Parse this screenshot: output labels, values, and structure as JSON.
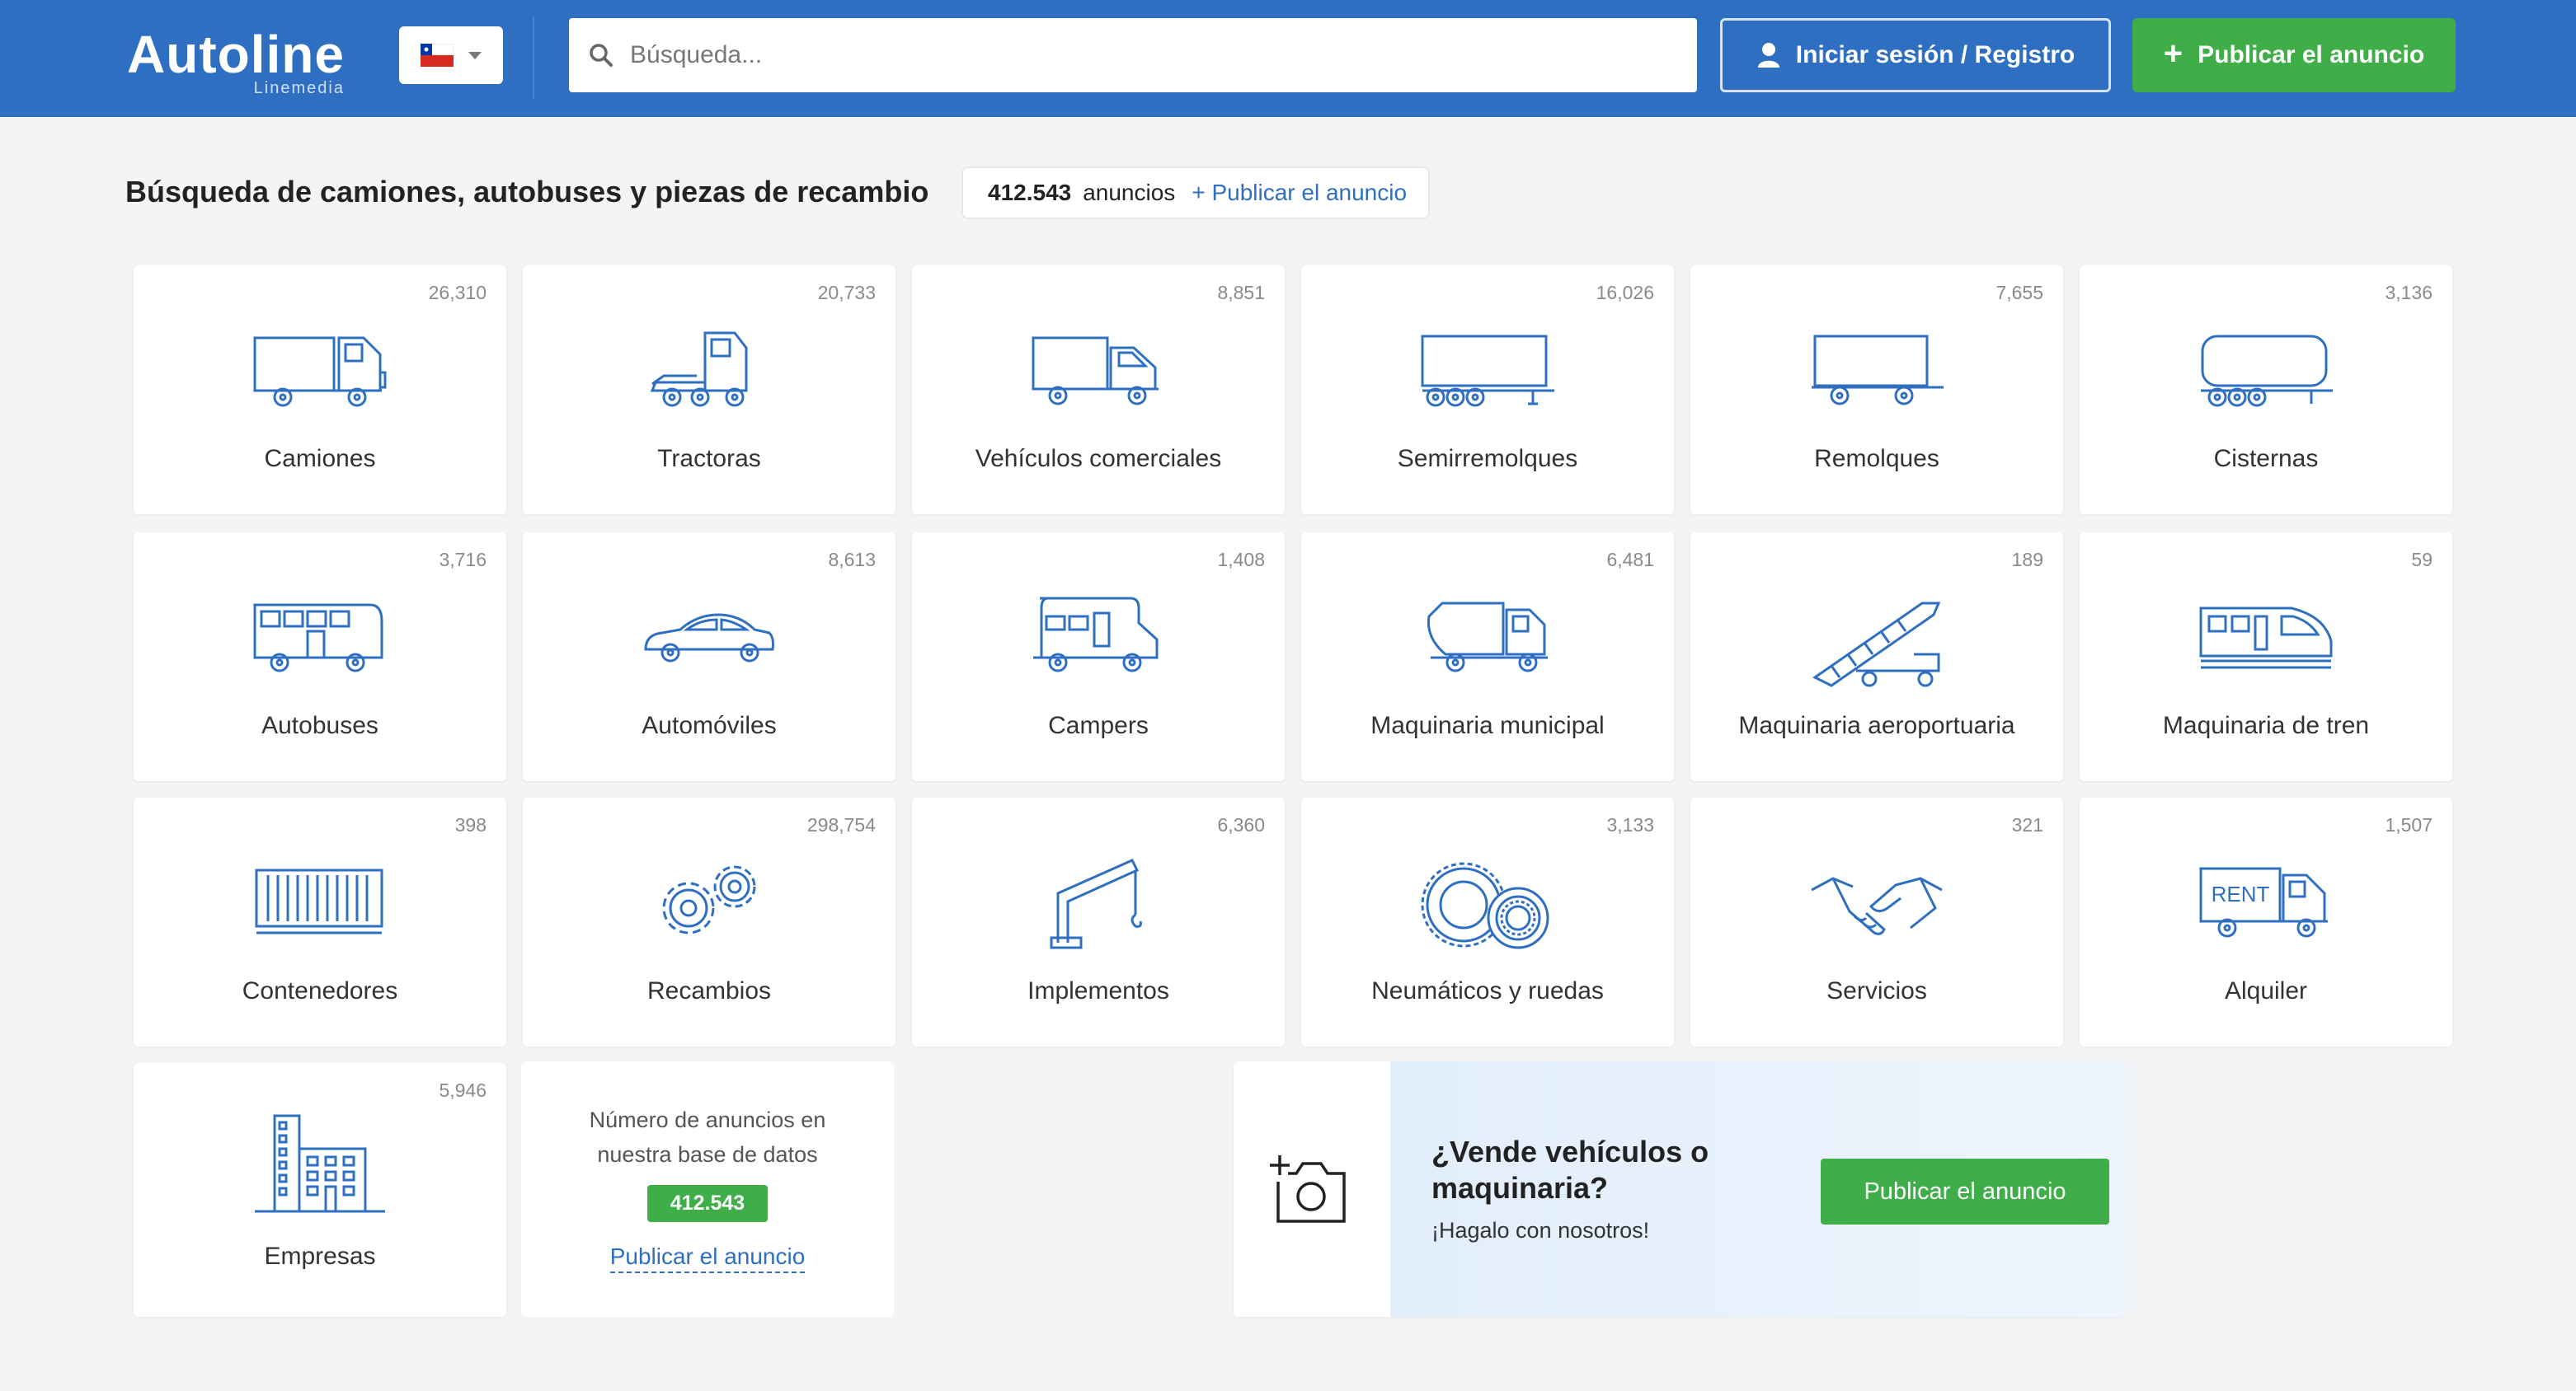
{
  "header": {
    "logo_text": "Autoline",
    "logo_sub": "Linemedia",
    "search_placeholder": "Búsqueda...",
    "login_label": "Iniciar sesión / Registro",
    "publish_label": "Publicar el anuncio",
    "flag": "chile-flag-icon"
  },
  "title_row": {
    "title": "Búsqueda de camiones, autobuses y piezas de recambio",
    "count": "412.543",
    "count_label": "anuncios",
    "publish_link": "+ Publicar el anuncio"
  },
  "categories": [
    {
      "label": "Camiones",
      "count": "26,310",
      "icon": "truck-icon"
    },
    {
      "label": "Tractoras",
      "count": "20,733",
      "icon": "tractor-unit-icon"
    },
    {
      "label": "Vehículos comerciales",
      "count": "8,851",
      "icon": "commercial-vehicle-icon"
    },
    {
      "label": "Semirremolques",
      "count": "16,026",
      "icon": "semitrailer-icon"
    },
    {
      "label": "Remolques",
      "count": "7,655",
      "icon": "trailer-icon"
    },
    {
      "label": "Cisternas",
      "count": "3,136",
      "icon": "tanker-icon"
    },
    {
      "label": "Autobuses",
      "count": "3,716",
      "icon": "bus-icon"
    },
    {
      "label": "Automóviles",
      "count": "8,613",
      "icon": "car-icon"
    },
    {
      "label": "Campers",
      "count": "1,408",
      "icon": "camper-icon"
    },
    {
      "label": "Maquinaria municipal",
      "count": "6,481",
      "icon": "municipal-truck-icon"
    },
    {
      "label": "Maquinaria aeroportuaria",
      "count": "189",
      "icon": "airport-stairs-icon"
    },
    {
      "label": "Maquinaria de tren",
      "count": "59",
      "icon": "train-icon"
    },
    {
      "label": "Contenedores",
      "count": "398",
      "icon": "container-icon"
    },
    {
      "label": "Recambios",
      "count": "298,754",
      "icon": "gears-icon"
    },
    {
      "label": "Implementos",
      "count": "6,360",
      "icon": "crane-arm-icon"
    },
    {
      "label": "Neumáticos y ruedas",
      "count": "3,133",
      "icon": "tire-bearing-icon"
    },
    {
      "label": "Servicios",
      "count": "321",
      "icon": "handshake-icon"
    },
    {
      "label": "Alquiler",
      "count": "1,507",
      "icon": "rent-truck-icon"
    },
    {
      "label": "Empresas",
      "count": "5,946",
      "icon": "building-icon"
    }
  ],
  "info_card": {
    "text_line1": "Número de anuncios en",
    "text_line2": "nuestra base de datos",
    "badge": "412.543",
    "link": "Publicar el anuncio"
  },
  "promo": {
    "title": "¿Vende vehículos o maquinaria?",
    "subtitle": "¡Hagalo con nosotros!",
    "button": "Publicar el anuncio",
    "icon": "add-photo-icon"
  },
  "colors": {
    "header_bg": "#2f6fc1",
    "accent_green": "#3fae49",
    "icon_blue": "#2f6fc1",
    "page_bg": "#f3f4f6"
  }
}
